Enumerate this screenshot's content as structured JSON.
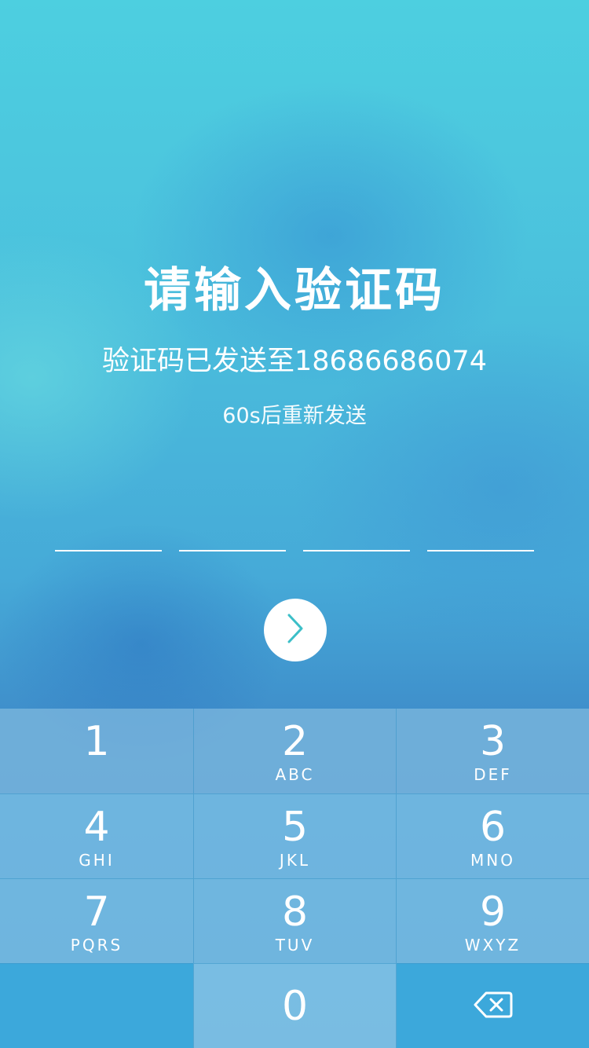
{
  "header": {
    "title": "请输入验证码",
    "subtitle": "验证码已发送至18686686074",
    "resend_text": "60s后重新发送"
  },
  "code_input": {
    "slots": [
      "",
      "",
      "",
      ""
    ]
  },
  "actions": {
    "next_icon": "chevron-right-icon"
  },
  "keypad": {
    "keys": [
      {
        "number": "1",
        "letters": ""
      },
      {
        "number": "2",
        "letters": "ABC"
      },
      {
        "number": "3",
        "letters": "DEF"
      },
      {
        "number": "4",
        "letters": "GHI"
      },
      {
        "number": "5",
        "letters": "JKL"
      },
      {
        "number": "6",
        "letters": "MNO"
      },
      {
        "number": "7",
        "letters": "PQRS"
      },
      {
        "number": "8",
        "letters": "TUV"
      },
      {
        "number": "9",
        "letters": "WXYZ"
      },
      {
        "number": "0",
        "letters": ""
      }
    ],
    "delete_icon": "backspace-icon"
  },
  "colors": {
    "accent": "#3cbfc8",
    "background_top": "#4dcfe0",
    "background_bottom": "#3f86c6"
  }
}
